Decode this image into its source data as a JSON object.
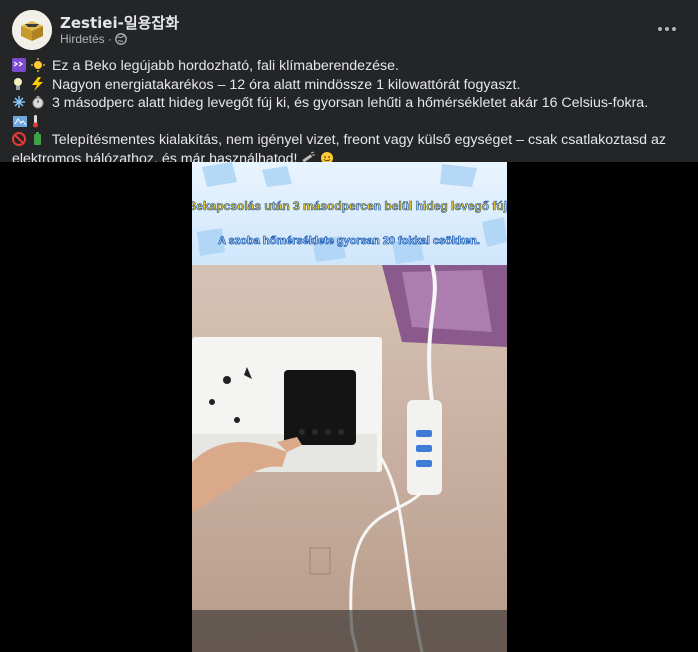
{
  "header": {
    "page_name": "Zestiei-일용잡화",
    "subtitle": "Hirdetés",
    "subtitle_sep": "·"
  },
  "post": {
    "line1": "Ez a Beko legújabb hordozható, fali klímaberendezése.",
    "line2": "Nagyon energiatakarékos – 12 óra alatt mindössze 1 kilowattórát fogyaszt.",
    "line3": "3 másodperc alatt hideg levegőt fúj ki, és gyorsan lehűti a hőmérsékletet akár 16 Celsius-fokra.",
    "line4": "Telepítésmentes kialakítás, nem igényel vizet, freont vagy külső egységet – csak csatlakoztasd az elektromos hálózathoz, és már használhatod!"
  },
  "video": {
    "caption1": "Bekapcsolás után 3 másodpercen belül hideg levegő fúj.",
    "caption2": "A szoba hőmérséklete gyorsan 20 fokkal csökken."
  },
  "colors": {
    "background": "#242526",
    "text": "#e4e6eb",
    "secondary": "#b0b3b8",
    "caption_yellow": "#ffd21a"
  },
  "icons": [
    "more-icon",
    "globe-icon",
    "emoji-icons",
    "avatar-logo"
  ]
}
